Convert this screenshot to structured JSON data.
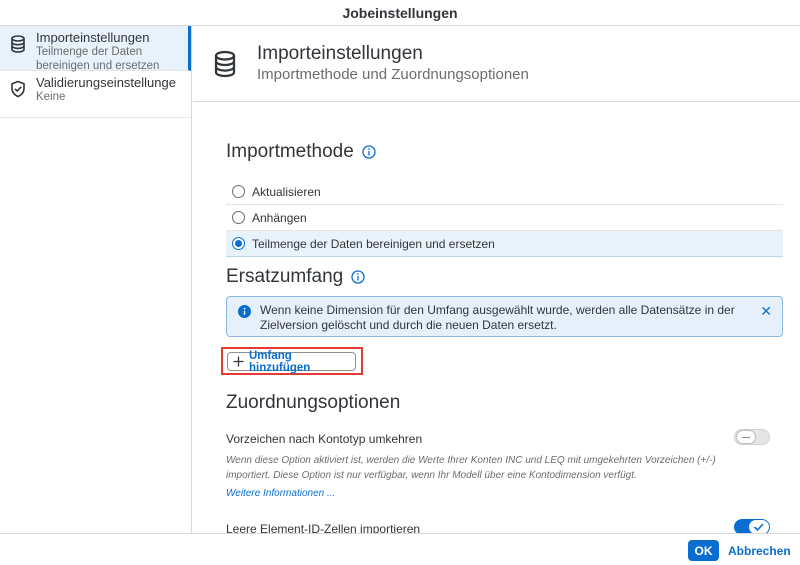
{
  "dialog": {
    "title": "Jobeinstellungen"
  },
  "sidebar": {
    "items": [
      {
        "title": "Importeinstellungen",
        "subtitle": "Teilmenge der Daten bereinigen und ersetzen",
        "icon": "database-icon",
        "active": true
      },
      {
        "title": "Validierungseinstellunge",
        "subtitle": "Keine",
        "icon": "shield-icon",
        "active": false
      }
    ]
  },
  "header": {
    "title": "Importeinstellungen",
    "subtitle": "Importmethode und Zuordnungsoptionen",
    "icon": "database-icon"
  },
  "import_method": {
    "title": "Importmethode",
    "options": [
      {
        "label": "Aktualisieren",
        "selected": false
      },
      {
        "label": "Anhängen",
        "selected": false
      },
      {
        "label": "Teilmenge der Daten bereinigen und ersetzen",
        "selected": true
      }
    ]
  },
  "scope": {
    "title": "Ersatzumfang",
    "info_text": "Wenn keine Dimension für den Umfang ausgewählt wurde, werden alle Datensätze in der Zielversion gelöscht und durch die neuen Daten ersetzt.",
    "close_glyph": "✕",
    "add_button_label": "Umfang hinzufügen"
  },
  "mapping": {
    "title": "Zuordnungsoptionen",
    "options": [
      {
        "label": "Vorzeichen nach Kontotyp umkehren",
        "enabled": false,
        "description": "Wenn diese Option aktiviert ist, werden die Werte Ihrer Konten INC und LEQ mit umgekehrten Vorzeichen (+/-) importiert. Diese Option ist nur verfügbar, wenn Ihr Modell über eine Kontodimension verfügt.",
        "link": "Weitere Informationen ..."
      },
      {
        "label": "Leere Element-ID-Zellen importieren",
        "enabled": true
      }
    ]
  },
  "footer": {
    "ok_label": "OK",
    "cancel_label": "Abbrechen"
  },
  "colors": {
    "accent": "#0a6ed1",
    "selection_bg": "#e8f2fb",
    "info_bg": "#e5f0fa",
    "highlight_border": "#e53935"
  }
}
